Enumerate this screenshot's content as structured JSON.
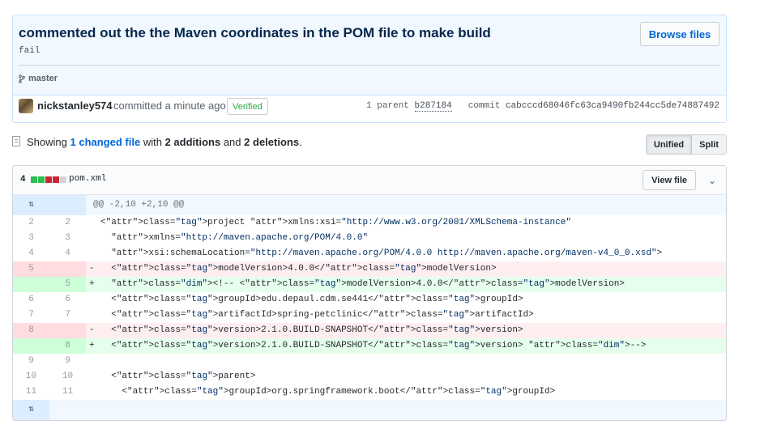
{
  "commit": {
    "title": "commented out the the Maven coordinates in the POM file to make build",
    "description": "fail",
    "browse_label": "Browse files",
    "branch": "master",
    "author": "nickstanley574",
    "action": "committed a minute ago",
    "verified": "Verified",
    "parent_label": "1 parent",
    "parent_sha": "b287184",
    "commit_label": "commit",
    "commit_sha": "cabcccd68046fc63ca9490fb244cc5de74887492"
  },
  "toc": {
    "prefix": "Showing",
    "changed": "1 changed file",
    "with": "with",
    "additions": "2 additions",
    "and": "and",
    "deletions": "2 deletions",
    "period": ".",
    "unified_label": "Unified",
    "split_label": "Split"
  },
  "file": {
    "changes": "4",
    "name": "pom.xml",
    "view_label": "View file",
    "diffstat_colors": [
      "#2cbe4e",
      "#2cbe4e",
      "#cb2431",
      "#cb2431",
      "#d1d5da"
    ],
    "hunk_header": "@@ -2,10 +2,10 @@",
    "lines": [
      {
        "type": "ctx",
        "old": "2",
        "new": "2",
        "sign": "",
        "text": "<project xmlns:xsi=\"http://www.w3.org/2001/XMLSchema-instance\""
      },
      {
        "type": "ctx",
        "old": "3",
        "new": "3",
        "sign": "",
        "text": "  xmlns=\"http://maven.apache.org/POM/4.0.0\""
      },
      {
        "type": "ctx",
        "old": "4",
        "new": "4",
        "sign": "",
        "text": "  xsi:schemaLocation=\"http://maven.apache.org/POM/4.0.0 http://maven.apache.org/maven-v4_0_0.xsd\">"
      },
      {
        "type": "del",
        "old": "5",
        "new": "",
        "sign": "-",
        "text": "  <modelVersion>4.0.0</modelVersion>"
      },
      {
        "type": "add",
        "old": "",
        "new": "5",
        "sign": "+",
        "text": "  <!-- <modelVersion>4.0.0</modelVersion>"
      },
      {
        "type": "ctx",
        "old": "6",
        "new": "6",
        "sign": "",
        "text": "  <groupId>edu.depaul.cdm.se441</groupId>"
      },
      {
        "type": "ctx",
        "old": "7",
        "new": "7",
        "sign": "",
        "text": "  <artifactId>spring-petclinic</artifactId>"
      },
      {
        "type": "del",
        "old": "8",
        "new": "",
        "sign": "-",
        "text": "  <version>2.1.0.BUILD-SNAPSHOT</version>"
      },
      {
        "type": "add",
        "old": "",
        "new": "8",
        "sign": "+",
        "text": "  <version>2.1.0.BUILD-SNAPSHOT</version> -->"
      },
      {
        "type": "ctx",
        "old": "9",
        "new": "9",
        "sign": "",
        "text": ""
      },
      {
        "type": "ctx",
        "old": "10",
        "new": "10",
        "sign": "",
        "text": "  <parent>"
      },
      {
        "type": "ctx",
        "old": "11",
        "new": "11",
        "sign": "",
        "text": "    <groupId>org.springframework.boot</groupId>"
      }
    ]
  },
  "icons": {
    "branch": "git-branch-icon",
    "file": "file-diff-icon",
    "expand": "unfold-icon",
    "chevron": "chevron-down-icon"
  }
}
